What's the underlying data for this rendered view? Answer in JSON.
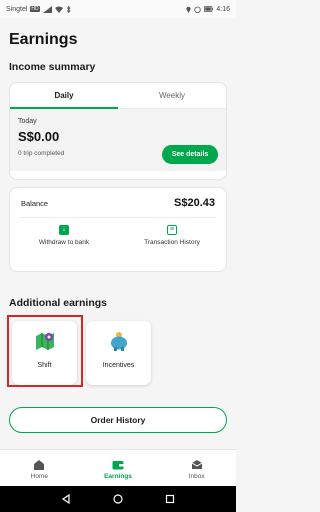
{
  "status_bar": {
    "carrier": "Singtel",
    "network_badge": "HD",
    "time": "4:16",
    "icons": [
      "signal-icon",
      "wifi-icon",
      "bluetooth-icon",
      "location-icon",
      "alarm-icon",
      "battery-icon"
    ]
  },
  "page": {
    "title": "Earnings"
  },
  "income_summary": {
    "title": "Income summary",
    "tabs": [
      {
        "label": "Daily",
        "active": true
      },
      {
        "label": "Weekly",
        "active": false
      }
    ],
    "today_label": "Today",
    "amount": "S$0.00",
    "trips": "0 trip completed",
    "details_button": "See details"
  },
  "balance": {
    "label": "Balance",
    "value": "S$20.43",
    "actions": [
      {
        "label": "Withdraw to bank",
        "icon": "download-icon"
      },
      {
        "label": "Transaction History",
        "icon": "history-icon"
      }
    ]
  },
  "additional": {
    "title": "Additional earnings",
    "tiles": [
      {
        "label": "Shift",
        "icon": "shift-map-icon"
      },
      {
        "label": "Incentives",
        "icon": "piggy-bank-icon"
      }
    ]
  },
  "order_history_button": "Order History",
  "bottom_nav": [
    {
      "label": "Home",
      "icon": "home-icon",
      "active": false
    },
    {
      "label": "Earnings",
      "icon": "wallet-icon",
      "active": true
    },
    {
      "label": "Inbox",
      "icon": "inbox-icon",
      "active": false
    }
  ],
  "colors": {
    "accent": "#00a84d",
    "highlight": "#d6262a",
    "background": "#f4f5f4"
  }
}
